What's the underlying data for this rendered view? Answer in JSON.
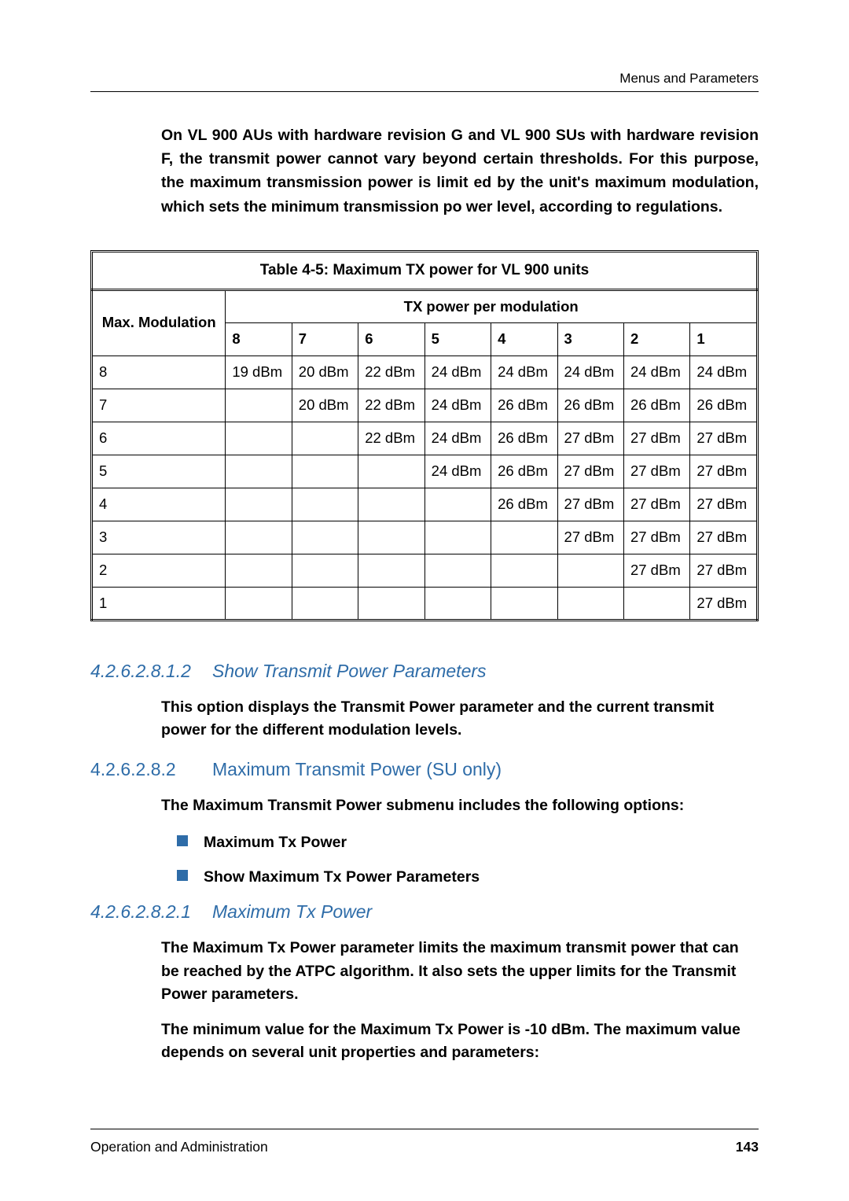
{
  "header": {
    "section": "Menus and Parameters"
  },
  "intro": "On VL 900 AUs with hardware revision G and VL 900 SUs with hardware revision F, the transmit power cannot vary beyond certain thresholds. For this purpose, the maximum transmission power is limit   ed by the unit's maximum modulation, which sets the minimum transmission po   wer level, according to regulations.",
  "table": {
    "caption": "Table 4-5: Maximum TX power for VL 900 units",
    "maxmod_label": "Max. Modulation",
    "span_label": "TX power per modulation",
    "cols": [
      "8",
      "7",
      "6",
      "5",
      "4",
      "3",
      "2",
      "1"
    ],
    "rows": [
      {
        "key": "8",
        "cells": [
          "19 dBm",
          "20 dBm",
          "22 dBm",
          "24 dBm",
          "24 dBm",
          "24 dBm",
          "24 dBm",
          "24 dBm"
        ]
      },
      {
        "key": "7",
        "cells": [
          "",
          "20 dBm",
          "22 dBm",
          "24 dBm",
          "26 dBm",
          "26 dBm",
          "26 dBm",
          "26 dBm"
        ]
      },
      {
        "key": "6",
        "cells": [
          "",
          "",
          "22 dBm",
          "24 dBm",
          "26 dBm",
          "27 dBm",
          "27 dBm",
          "27 dBm"
        ]
      },
      {
        "key": "5",
        "cells": [
          "",
          "",
          "",
          "24 dBm",
          "26 dBm",
          "27 dBm",
          "27 dBm",
          "27 dBm"
        ]
      },
      {
        "key": "4",
        "cells": [
          "",
          "",
          "",
          "",
          "26 dBm",
          "27 dBm",
          "27 dBm",
          "27 dBm"
        ]
      },
      {
        "key": "3",
        "cells": [
          "",
          "",
          "",
          "",
          "",
          "27 dBm",
          "27 dBm",
          "27 dBm"
        ]
      },
      {
        "key": "2",
        "cells": [
          "",
          "",
          "",
          "",
          "",
          "",
          "27 dBm",
          "27 dBm"
        ]
      },
      {
        "key": "1",
        "cells": [
          "",
          "",
          "",
          "",
          "",
          "",
          "",
          "27 dBm"
        ]
      }
    ]
  },
  "sections": {
    "s1": {
      "num": "4.2.6.2.8.1.2",
      "title": "Show Transmit Power Parameters",
      "para": "This option displays the Transmit Power parameter and the current transmit power for the different modulation levels."
    },
    "s2": {
      "num": "4.2.6.2.8.2",
      "title": "Maximum Transmit Power (SU only)",
      "para": "The Maximum Transmit Power submenu includes the following options:",
      "bullets": [
        "Maximum Tx Power",
        "Show Maximum Tx Power Parameters"
      ]
    },
    "s3": {
      "num": "4.2.6.2.8.2.1",
      "title": "Maximum Tx Power",
      "p1": "The Maximum Tx Power parameter limits the maximum transmit power that can be reached by the ATPC algorithm. It also sets the upper limits for the Transmit Power parameters.",
      "p2": "The minimum value for the Maximum Tx Power is -10 dBm. The maximum value depends on several unit properties and parameters:"
    }
  },
  "footer": {
    "left": "Operation and Administration",
    "page": "143"
  },
  "chart_data": {
    "type": "table",
    "title": "Table 4-5: Maximum TX power for VL 900 units",
    "xlabel": "TX power per modulation (column = modulation index)",
    "ylabel": "Max. Modulation (row)",
    "columns": [
      8,
      7,
      6,
      5,
      4,
      3,
      2,
      1
    ],
    "rows_index": [
      8,
      7,
      6,
      5,
      4,
      3,
      2,
      1
    ],
    "unit": "dBm",
    "values": [
      [
        19,
        20,
        22,
        24,
        24,
        24,
        24,
        24
      ],
      [
        null,
        20,
        22,
        24,
        26,
        26,
        26,
        26
      ],
      [
        null,
        null,
        22,
        24,
        26,
        27,
        27,
        27
      ],
      [
        null,
        null,
        null,
        24,
        26,
        27,
        27,
        27
      ],
      [
        null,
        null,
        null,
        null,
        26,
        27,
        27,
        27
      ],
      [
        null,
        null,
        null,
        null,
        null,
        27,
        27,
        27
      ],
      [
        null,
        null,
        null,
        null,
        null,
        null,
        27,
        27
      ],
      [
        null,
        null,
        null,
        null,
        null,
        null,
        null,
        27
      ]
    ]
  }
}
